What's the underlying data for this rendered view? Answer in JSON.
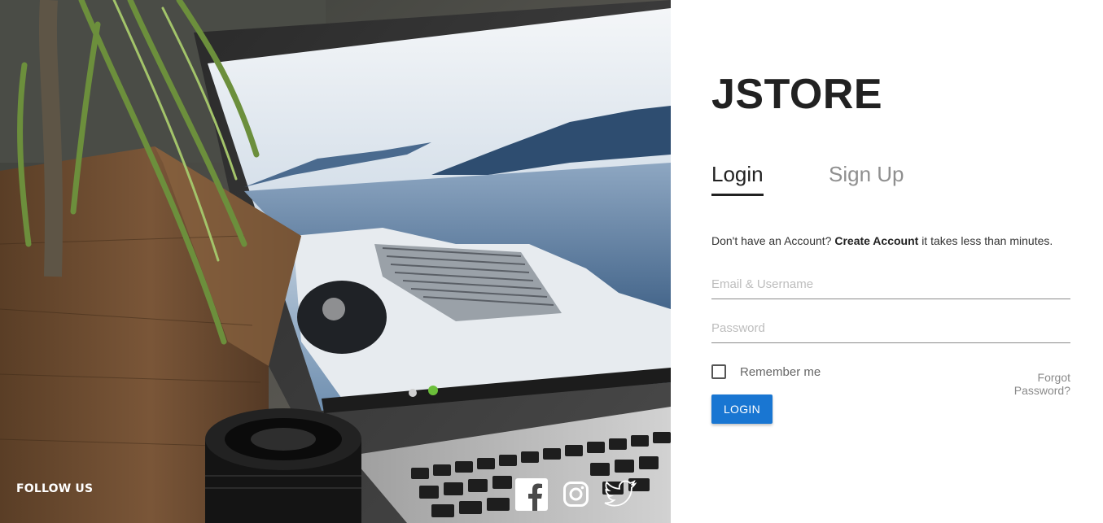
{
  "hero": {
    "follow_label": "FOLLOW US",
    "social": [
      {
        "icon": "facebook-icon"
      },
      {
        "icon": "instagram-icon"
      },
      {
        "icon": "twitter-icon"
      }
    ]
  },
  "brand": {
    "name": "JSTORE"
  },
  "tabs": [
    {
      "label": "Login",
      "active": true
    },
    {
      "label": "Sign Up",
      "active": false
    }
  ],
  "intro": {
    "prefix": "Don't have an Account?",
    "link": "Create Account",
    "suffix": "it takes less than minutes."
  },
  "form": {
    "email_placeholder": "Email & Username",
    "email_value": "",
    "password_placeholder": "Password",
    "password_value": "",
    "remember_label": "Remember me",
    "remember_checked": false,
    "forgot_label": "Forgot Password?",
    "submit_label": "LOGIN"
  },
  "colors": {
    "accent": "#1976d2",
    "text": "#212121",
    "muted": "#8f8f8f"
  }
}
